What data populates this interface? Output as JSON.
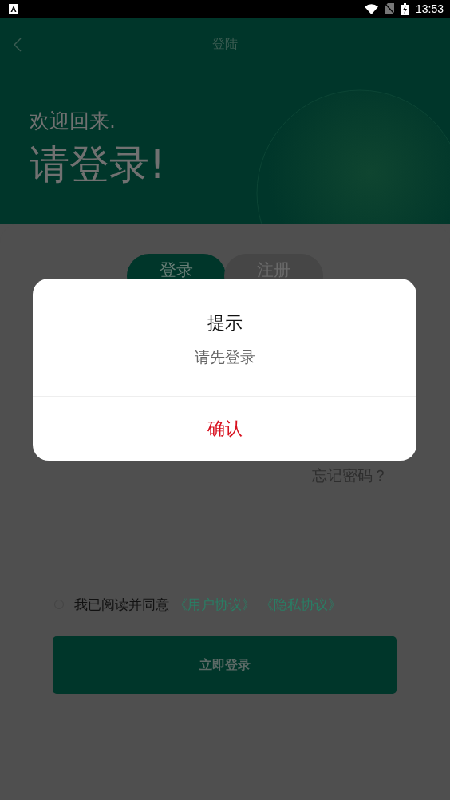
{
  "status_bar": {
    "time": "13:53"
  },
  "nav": {
    "title": "登陆"
  },
  "header": {
    "greeting": "欢迎回来.",
    "heading": "请登录!"
  },
  "tabs": [
    {
      "label": "登录",
      "selected": true
    },
    {
      "label": "注册",
      "selected": false
    }
  ],
  "forgot_password": "忘记密码？",
  "agreement": {
    "checked": false,
    "text": "我已阅读并同意",
    "links": [
      "《用户协议》",
      "《隐私协议》"
    ]
  },
  "login_button": "立即登录",
  "dialog": {
    "title": "提示",
    "message": "请先登录",
    "confirm": "确认"
  }
}
